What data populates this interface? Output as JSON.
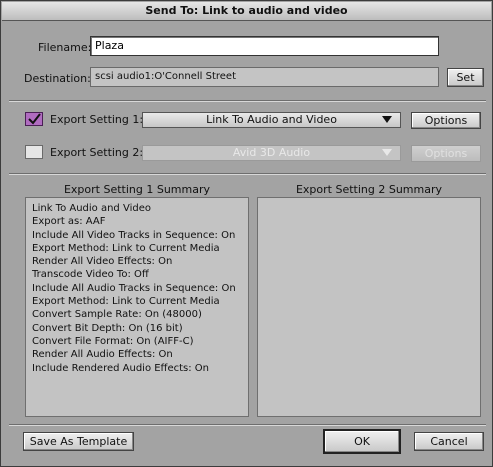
{
  "window": {
    "title": "Send To: Link to audio and video"
  },
  "filename": {
    "label": "Filename:",
    "value": "Plaza"
  },
  "destination": {
    "label": "Destination:",
    "value": "scsi audio1:O'Connell Street",
    "set_label": "Set"
  },
  "export1": {
    "label": "Export Setting 1:",
    "value": "Link To Audio and Video",
    "options_label": "Options",
    "checked": true
  },
  "export2": {
    "label": "Export Setting 2:",
    "value": "Avid 3D Audio",
    "options_label": "Options",
    "checked": false
  },
  "summary1": {
    "title": "Export Setting 1 Summary",
    "lines": [
      "Link To Audio and Video",
      "Export as: AAF",
      "Include All Video Tracks in Sequence: On",
      "Export Method: Link to Current Media",
      "Render All Video Effects: On",
      "Transcode Video To: Off",
      "Include All Audio Tracks in Sequence: On",
      "Export Method: Link to Current Media",
      "Convert Sample Rate: On  (48000)",
      "Convert Bit Depth: On  (16 bit)",
      "Convert File Format: On  (AIFF-C)",
      "Render All Audio Effects: On",
      "Include Rendered Audio Effects: On"
    ]
  },
  "summary2": {
    "title": "Export Setting 2 Summary"
  },
  "buttons": {
    "save_template": "Save As Template",
    "ok": "OK",
    "cancel": "Cancel"
  },
  "colors": {
    "checkbox_on": "#b06cc0",
    "dialog_bg": "#a3a3a3"
  }
}
